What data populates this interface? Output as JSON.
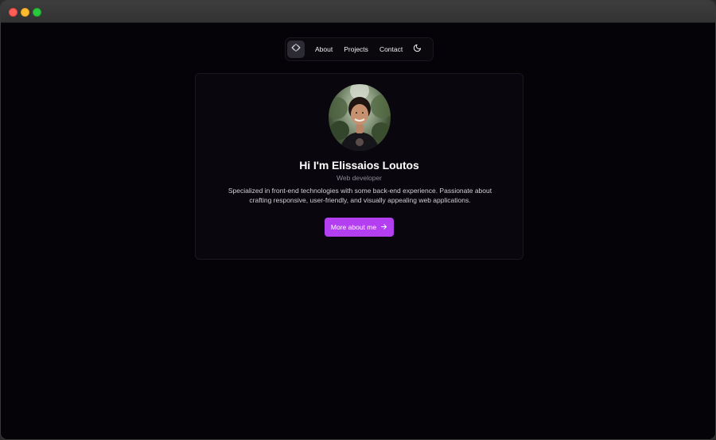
{
  "nav": {
    "logo_icon": "code-brackets-icon",
    "links": [
      "About",
      "Projects",
      "Contact"
    ],
    "theme_icon": "moon-icon"
  },
  "hero": {
    "title": "Hi I'm Elissaios Loutos",
    "role": "Web developer",
    "description": "Specialized in front-end technologies with some back-end experience. Passionate about crafting responsive, user-friendly, and visually appealing web applications.",
    "cta_label": "More about me",
    "cta_icon": "arrow-right-icon",
    "avatar": "profile-photo"
  },
  "colors": {
    "background": "#050307",
    "card": "#09070d",
    "accent": "#b43ff1",
    "muted_text": "#8e8b95"
  }
}
